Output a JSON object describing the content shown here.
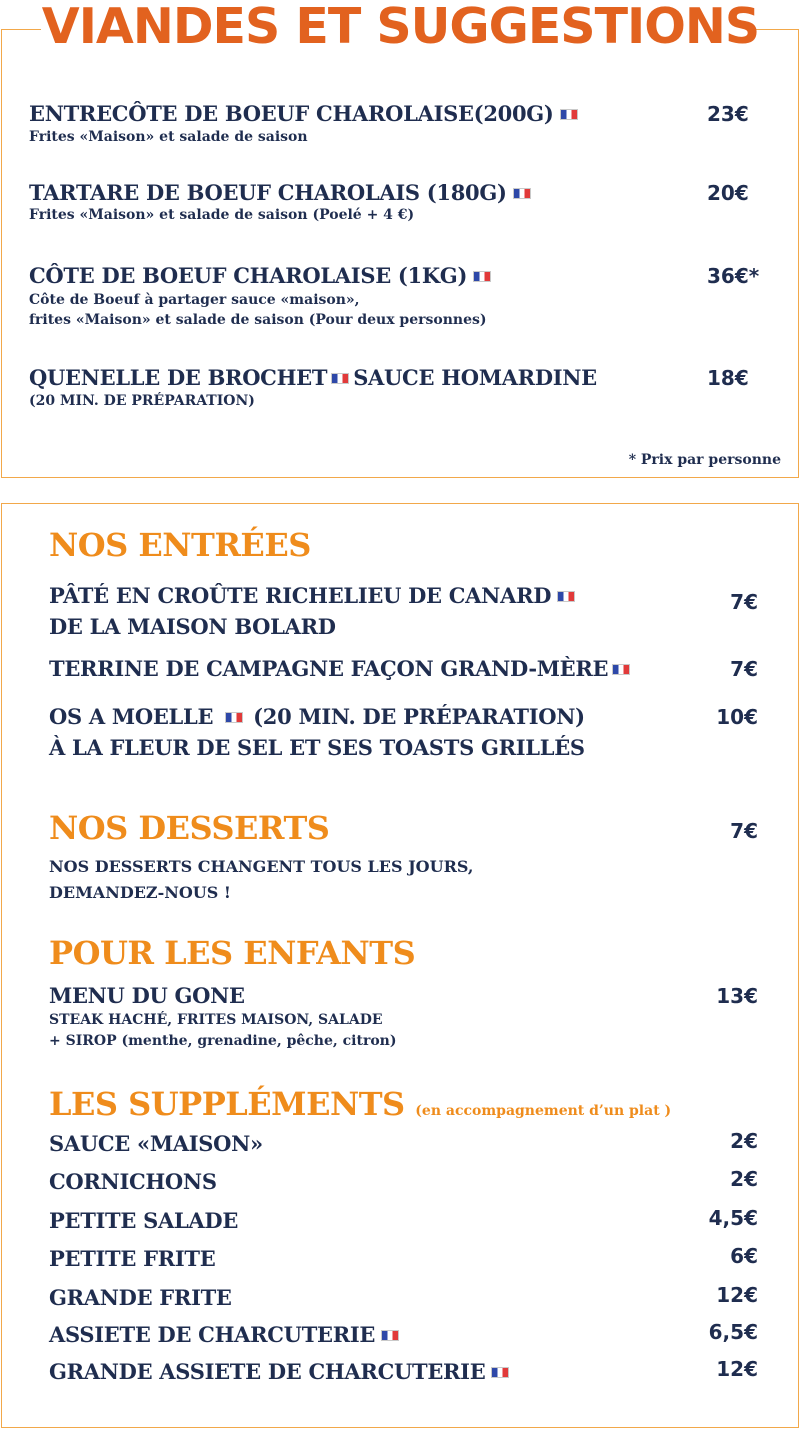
{
  "header": {
    "title": "VIANDES ET SUGGESTIONS"
  },
  "viandes": {
    "items": [
      {
        "name": "ENTRECÔTE DE BOEUF CHAROLAISE(200G)",
        "desc1": "Frites «Maison» et salade de saison",
        "price": "23€",
        "flag": "french-flag-icon"
      },
      {
        "name": "TARTARE DE BOEUF CHAROLAIS (180G)",
        "desc1": "Frites «Maison» et salade de saison (Poelé + 4 €)",
        "price": "20€",
        "flag": "french-flag-icon"
      },
      {
        "name": "CÔTE DE BOEUF CHAROLAISE (1KG)",
        "desc1": "Côte de Boeuf à partager sauce «maison»,",
        "desc2": "frites «Maison» et salade de saison (Pour deux personnes)",
        "price": "36€*",
        "flag": "french-flag-icon"
      },
      {
        "name_a": "QUENELLE DE BROCHET",
        "name_b": "SAUCE HOMARDINE",
        "desc1": "(20 MIN. DE PRÉPARATION)",
        "price": "18€",
        "flag": "french-flag-icon"
      }
    ],
    "footnote": "* Prix par personne"
  },
  "entrees": {
    "title": "NOS ENTRÉES",
    "items": [
      {
        "line1": "PÂTÉ EN CROÛTE RICHELIEU DE CANARD",
        "line2": "DE LA MAISON BOLARD",
        "price": "7€"
      },
      {
        "line1": "TERRINE DE CAMPAGNE FAÇON GRAND-MÈRE",
        "price": "7€"
      },
      {
        "line1_a": "OS A MOELLE",
        "line1_b": "(20 MIN. DE PRÉPARATION)",
        "line2": "À LA FLEUR DE SEL ET SES TOASTS GRILLÉS",
        "price": "10€"
      }
    ]
  },
  "desserts": {
    "title": "NOS DESSERTS",
    "price": "7€",
    "line1": "NOS DESSERTS CHANGENT TOUS LES JOURS,",
    "line2": "DEMANDEZ-NOUS !"
  },
  "enfants": {
    "title": "POUR LES ENFANTS",
    "item": "MENU DU GONE",
    "price": "13€",
    "line1": "STEAK HACHÉ, FRITES MAISON, SALADE",
    "line2": "+ SIROP (menthe, grenadine, pêche, citron)"
  },
  "supplements": {
    "title": "LES SUPPLÉMENTS",
    "note": "(en accompagnement d’un plat )",
    "items": [
      {
        "name": "SAUCE «MAISON»",
        "price": "2€"
      },
      {
        "name": "CORNICHONS",
        "price": "2€"
      },
      {
        "name": "PETITE SALADE",
        "price": "4,5€"
      },
      {
        "name": "PETITE FRITE",
        "price": "6€"
      },
      {
        "name": "GRANDE FRITE",
        "price": "12€"
      },
      {
        "name": "ASSIETE DE CHARCUTERIE",
        "price": "6,5€",
        "flag": true
      },
      {
        "name": "GRANDE ASSIETE DE CHARCUTERIE",
        "price": "12€",
        "flag": true
      }
    ]
  },
  "colors": {
    "accent_title": "#e2621f",
    "accent_section": "#ef8c1c",
    "text": "#1f2d4f",
    "border": "#f2a84a"
  }
}
